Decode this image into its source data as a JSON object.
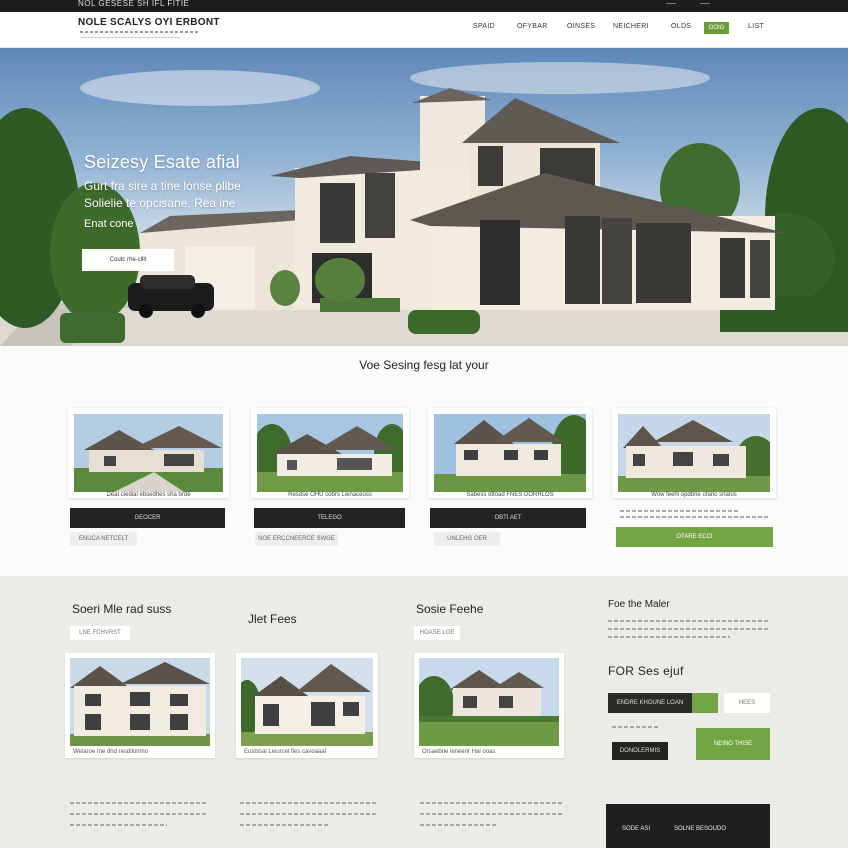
{
  "topbar": {
    "text": "NOL GESESE SH IFL FITIE"
  },
  "nav": {
    "brand": "NOLE SCALYS OYI ERBONT",
    "items": [
      "SPAID",
      "OFYBAR",
      "OINSES",
      "NEICHERI",
      "OLDS"
    ],
    "cta": "OOIG",
    "last": "LIST"
  },
  "hero": {
    "title": "Seizesy Esate afial",
    "subtitle1": "Gurt fra sire a tine lonse pllbe",
    "subtitle2": "Solielie te opcisane, Rea ine",
    "subtitle3": "Enat cone",
    "button": "Coutc rhe-cllit"
  },
  "featured": {
    "heading": "Voe Sesing fesg lat your",
    "cards": [
      {
        "caption": "Deat ciedial ebsedhes sha brde",
        "button": "GEOCER",
        "tag": "ENUCA NETCELT"
      },
      {
        "caption": "Resdse OHU cobrs Leinaceoss",
        "button": "TELEGO",
        "tag": "NOE ERCCNEERCE SWGE"
      },
      {
        "caption": "Sabess ottoad FNES DORRLOS",
        "button": "OBTI AET",
        "tag": "UNLEHG OER"
      },
      {
        "caption": "Wow feehl opdbrle ofarlo srlatos",
        "button": "OTARE ECCI",
        "tag": ""
      }
    ]
  },
  "bottom": {
    "col1": {
      "title": "Soeri Mle rad suss",
      "tag": "LNE FCHVRST",
      "caption": "Welaroe Ine dhd resdilonmo"
    },
    "col2": {
      "title": "Jlet Fees",
      "caption": "Eusbisal Leiurcel fies cavoaaal"
    },
    "col3": {
      "title": "Sosie Feehe",
      "tag": "HOASE LOE",
      "caption": "Orsaebrie leneerir Hal ooas"
    },
    "side": {
      "title": "Foe the Maler",
      "title2": "FOR Ses ejuf",
      "dark_button": "ENDRE KHOUNE LOAN",
      "light_button": "HEES",
      "dark_button2": "DONOLERMIS",
      "green_button": "NEINO THISE",
      "footer_left": "SODE ASI",
      "footer_right": "SOLNE BESOUDO"
    }
  },
  "colors": {
    "accent": "#74a544",
    "dark": "#242424"
  }
}
